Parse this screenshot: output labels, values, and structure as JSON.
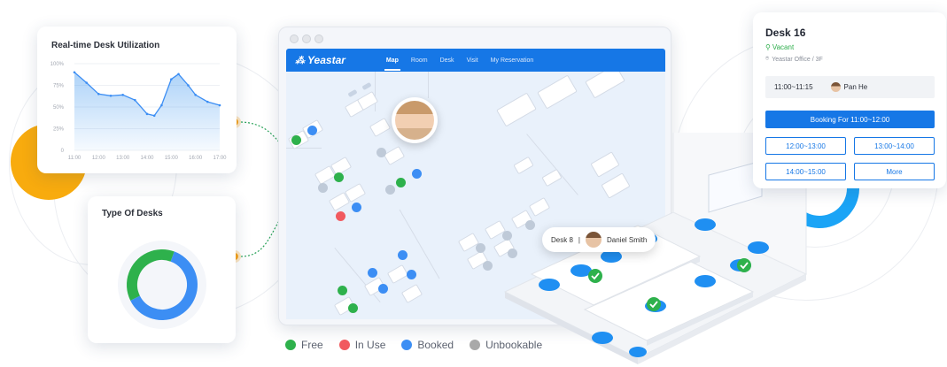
{
  "colors": {
    "free": "#2eb14c",
    "in_use": "#f15a5f",
    "booked": "#3c8ef4",
    "unbookable": "#a9a9a9",
    "accent": "#1677e6",
    "connector": "#f8a31a"
  },
  "utilization_card": {
    "title": "Real-time Desk Utilization",
    "chart_data": {
      "type": "area",
      "title": "Real-time Desk Utilization",
      "x": [
        "11:00",
        "12:00",
        "13:00",
        "14:00",
        "15:00",
        "16:00",
        "17:00"
      ],
      "y_ticks": [
        "100%",
        "75%",
        "50%",
        "25%",
        "0"
      ],
      "ylim": [
        0,
        100
      ],
      "series": [
        {
          "values": [
            {
              "x": 0,
              "y": 90
            },
            {
              "x": 0.5,
              "y": 78
            },
            {
              "x": 1,
              "y": 65
            },
            {
              "x": 1.5,
              "y": 63
            },
            {
              "x": 2,
              "y": 64
            },
            {
              "x": 2.5,
              "y": 58
            },
            {
              "x": 3,
              "y": 42
            },
            {
              "x": 3.3,
              "y": 40
            },
            {
              "x": 3.6,
              "y": 52
            },
            {
              "x": 4,
              "y": 82
            },
            {
              "x": 4.3,
              "y": 88
            },
            {
              "x": 4.7,
              "y": 75
            },
            {
              "x": 5,
              "y": 64
            },
            {
              "x": 5.5,
              "y": 56
            },
            {
              "x": 6,
              "y": 52
            }
          ]
        }
      ],
      "grid": true
    }
  },
  "type_card": {
    "title": "Type Of Desks",
    "chart_data": {
      "type": "pie",
      "slices": [
        {
          "value": 62,
          "color": "#3c8ef4"
        },
        {
          "value": 38,
          "color": "#2eb14c"
        }
      ]
    }
  },
  "app": {
    "logo": "Yeastar",
    "nav": [
      {
        "label": "Map",
        "active": true
      },
      {
        "label": "Room",
        "active": false
      },
      {
        "label": "Desk",
        "active": false
      },
      {
        "label": "Visit",
        "active": false
      },
      {
        "label": "My Reservation",
        "active": false
      }
    ]
  },
  "legend": [
    {
      "label": "Free",
      "color": "#2eb14c"
    },
    {
      "label": "In Use",
      "color": "#f15a5f"
    },
    {
      "label": "Booked",
      "color": "#3c8ef4"
    },
    {
      "label": "Unbookable",
      "color": "#a9a9a9"
    }
  ],
  "desk_tooltip": {
    "desk": "Desk 8",
    "separator": "|",
    "person": "Daniel Smith"
  },
  "booking_panel": {
    "title": "Desk 16",
    "status": "Vacant",
    "location": "Yeastar Office / 3F",
    "current_booking": {
      "time": "11:00~11:15",
      "person": "Pan He"
    },
    "primary_action": "Booking For 11:00~12:00",
    "slots": [
      "12:00~13:00",
      "13:00~14:00",
      "14:00~15:00",
      "More"
    ]
  }
}
